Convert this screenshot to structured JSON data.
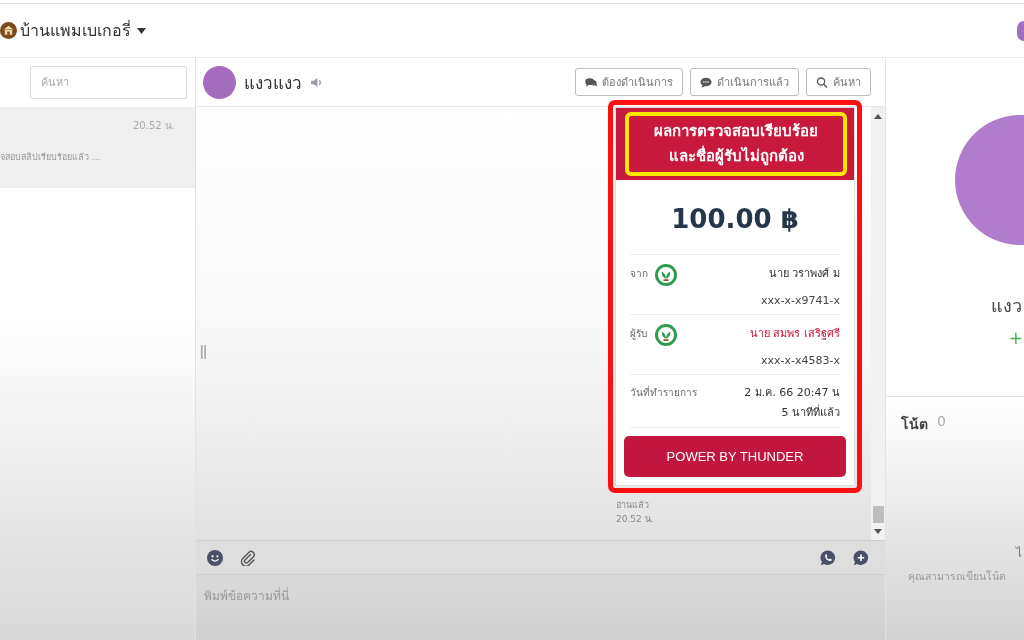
{
  "header": {
    "shop_name": "บ้านแพมเบเกอรี่"
  },
  "sidebar": {
    "search": {
      "placeholder": "ค้นหา"
    },
    "conversations": [
      {
        "time": "20.52 น.",
        "preview": "จสอบสลิปเรียบร้อยแล้ว ...",
        "selected": true
      }
    ]
  },
  "chat": {
    "contact_name": "แงวแงว",
    "actions": [
      {
        "label": "ต้องดำเนินการ",
        "kind": "comments"
      },
      {
        "label": "ดำเนินการแล้ว",
        "kind": "comment"
      },
      {
        "label": "ค้นหา",
        "kind": "search"
      }
    ],
    "message": {
      "highlight_frame": true,
      "title_highlight": true,
      "title": "ผลการตรวจสอบเรียบร้อย\nและชื่อผู้รับไม่ถูกต้อง",
      "amount": "100.00 ฿",
      "rows": [
        {
          "kind": "party",
          "label": "จาก",
          "name": "นาย วราพงศ์ ม",
          "account": "xxx-x-x9741-x",
          "mismatch": false
        },
        {
          "kind": "party",
          "label": "ผู้รับ",
          "name": "นาย สมพร เสริฐศรี",
          "account": "xxx-x-x4583-x",
          "mismatch": true
        },
        {
          "kind": "date",
          "label": "วันที่ทำรายการ",
          "value": "2 ม.ค. 66 20:47 น",
          "relative": "5 นาทีที่แล้ว"
        }
      ],
      "button": "POWER BY THUNDER",
      "read_status": "อ่านแล้ว",
      "time": "20.52 น."
    },
    "composer": {
      "placeholder": "พิมพ์ข้อความที่นี่"
    }
  },
  "profile": {
    "name": "แงว",
    "add_tag": "+"
  },
  "notes": {
    "title": "โน้ต",
    "count": "0",
    "empty_title": "ไ",
    "empty_hint": "คุณสามารถเขียนโน้ต"
  }
}
